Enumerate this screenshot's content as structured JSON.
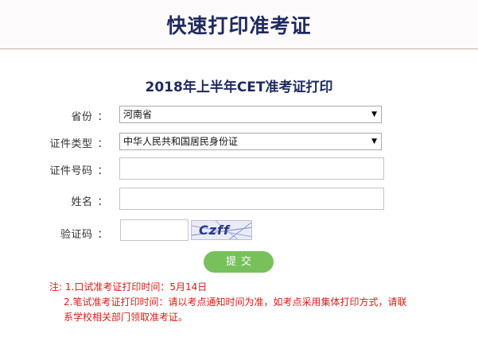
{
  "header": {
    "title": "快速打印准考证"
  },
  "form": {
    "title": "2018年上半年CET准考证打印",
    "fields": {
      "province": {
        "label": "省份",
        "value": "河南省"
      },
      "id_type": {
        "label": "证件类型",
        "value": "中华人民共和国居民身份证"
      },
      "id_number": {
        "label": "证件号码",
        "value": ""
      },
      "name": {
        "label": "姓名",
        "value": ""
      },
      "captcha": {
        "label": "验证码",
        "value": "",
        "image_text": "Czff"
      }
    },
    "colon": "：",
    "select_arrow": "▼",
    "submit_label": "提交"
  },
  "notes": {
    "prefix": "注:",
    "line1": "1.口试准考证打印时间：5月14日",
    "line2": "2.笔试准考证打印时间：请以考点通知时间为准，如考点采用集体打印方式，请联",
    "line3": "系学校相关部门领取准考证。"
  },
  "colors": {
    "title": "#1f2a60",
    "submit_button": "#77c05a",
    "notes": "#d0201a"
  }
}
